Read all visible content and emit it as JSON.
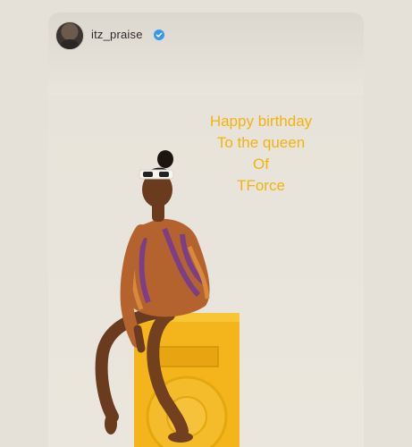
{
  "story": {
    "username": "itz_praise",
    "verified": true,
    "caption_lines": [
      "Happy birthday",
      "To the queen",
      "Of",
      "TForce"
    ],
    "colors": {
      "caption": "#f2b30f",
      "verified_badge": "#3797f0",
      "speaker": "#f3b51b"
    },
    "icons": [
      "avatar",
      "verified-icon"
    ]
  }
}
